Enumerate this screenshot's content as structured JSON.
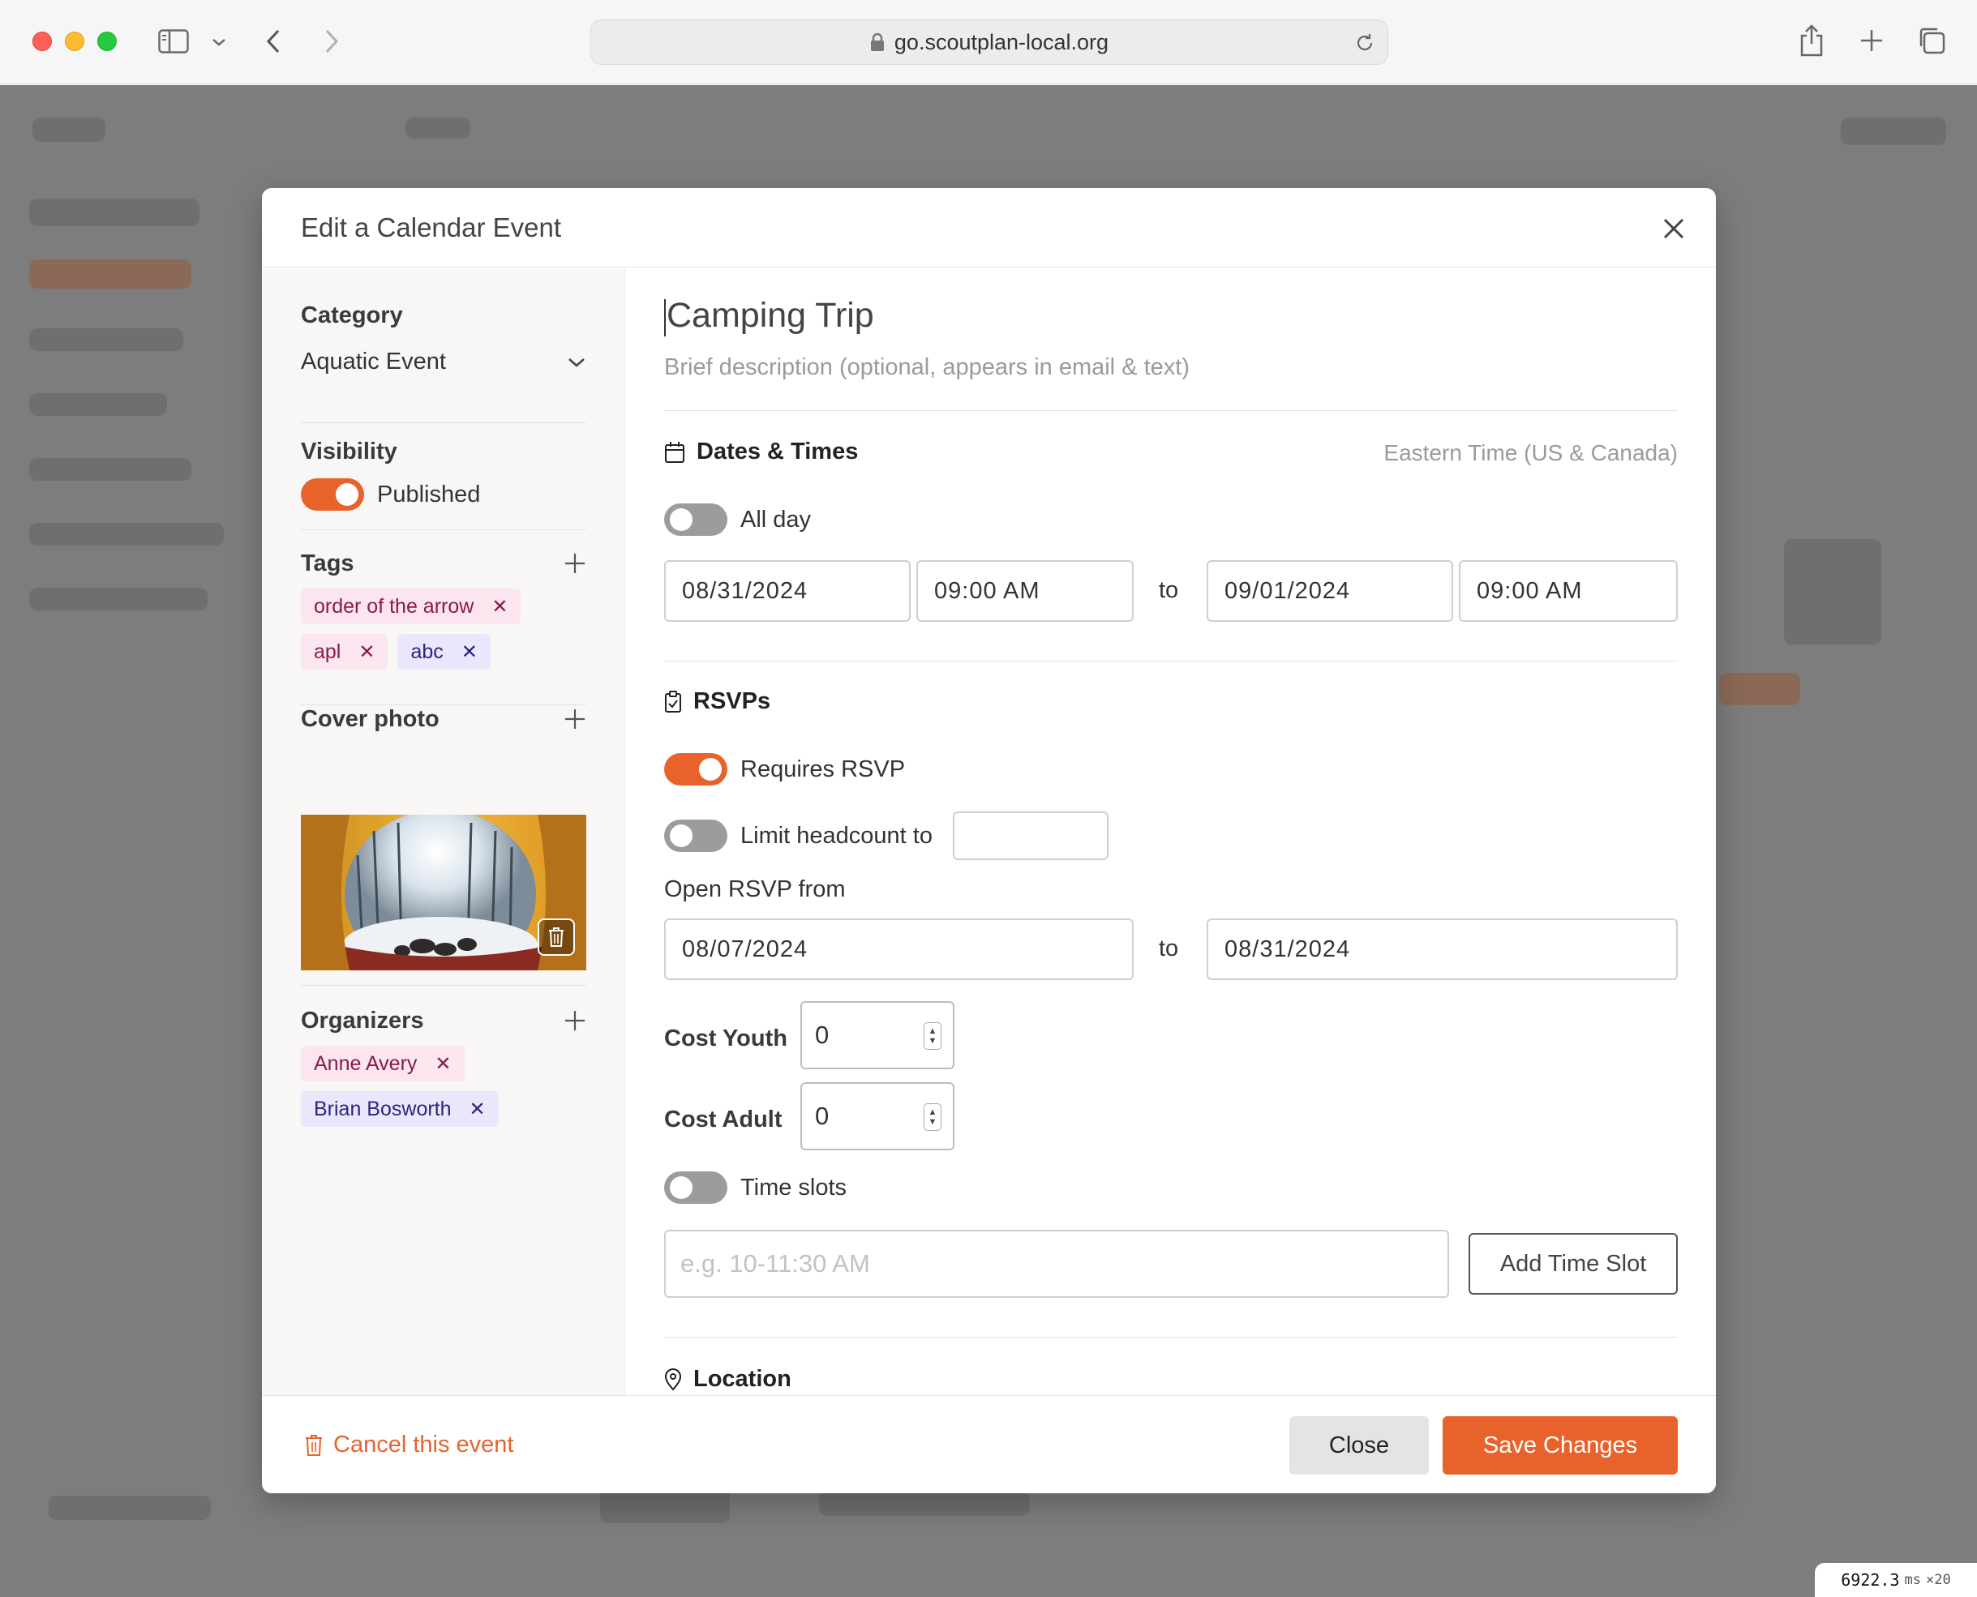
{
  "browser": {
    "url": "go.scoutplan-local.org"
  },
  "modal": {
    "title": "Edit a Calendar Event"
  },
  "sidebar": {
    "category": {
      "label": "Category",
      "value": "Aquatic Event"
    },
    "visibility": {
      "label": "Visibility",
      "toggle_label": "Published",
      "on": true
    },
    "tags": {
      "label": "Tags",
      "items": [
        {
          "label": "order of the arrow",
          "color": "#fbe6ef"
        },
        {
          "label": "apl",
          "color": "#fbe6ef"
        },
        {
          "label": "abc",
          "color": "#e9e7fb"
        }
      ]
    },
    "cover_photo": {
      "label": "Cover photo"
    },
    "organizers": {
      "label": "Organizers",
      "items": [
        {
          "label": "Anne Avery",
          "color": "#fbe6ef"
        },
        {
          "label": "Brian Bosworth",
          "color": "#e9e7fb"
        }
      ]
    }
  },
  "main": {
    "title": "Camping Trip",
    "description_placeholder": "Brief description (optional, appears in email & text)",
    "dates": {
      "heading": "Dates & Times",
      "timezone": "Eastern Time (US & Canada)",
      "all_day_label": "All day",
      "all_day_on": false,
      "start_date": "08/31/2024",
      "start_time": "09:00 AM",
      "to": "to",
      "end_date": "09/01/2024",
      "end_time": "09:00 AM"
    },
    "rsvps": {
      "heading": "RSVPs",
      "requires_label": "Requires RSVP",
      "requires_on": true,
      "limit_label": "Limit headcount to",
      "limit_on": false,
      "limit_value": "",
      "open_from_label": "Open RSVP from",
      "open_from": "08/07/2024",
      "to": "to",
      "open_to": "08/31/2024",
      "cost_youth_label": "Cost Youth",
      "cost_youth": "0",
      "cost_adult_label": "Cost Adult",
      "cost_adult": "0",
      "time_slots_label": "Time slots",
      "time_slots_on": false,
      "time_slot_placeholder": "e.g. 10-11:30 AM",
      "add_time_slot": "Add Time Slot"
    },
    "location": {
      "heading": "Location"
    }
  },
  "footer": {
    "cancel_event": "Cancel this event",
    "close": "Close",
    "save": "Save Changes"
  },
  "overlay": {
    "timer_value": "6922.3",
    "timer_unit": "ms",
    "timer_mult": "×20"
  },
  "colors": {
    "accent": "#e8632b",
    "toggle_off": "#9c9c9c",
    "backdrop": "#7d7d7d"
  }
}
